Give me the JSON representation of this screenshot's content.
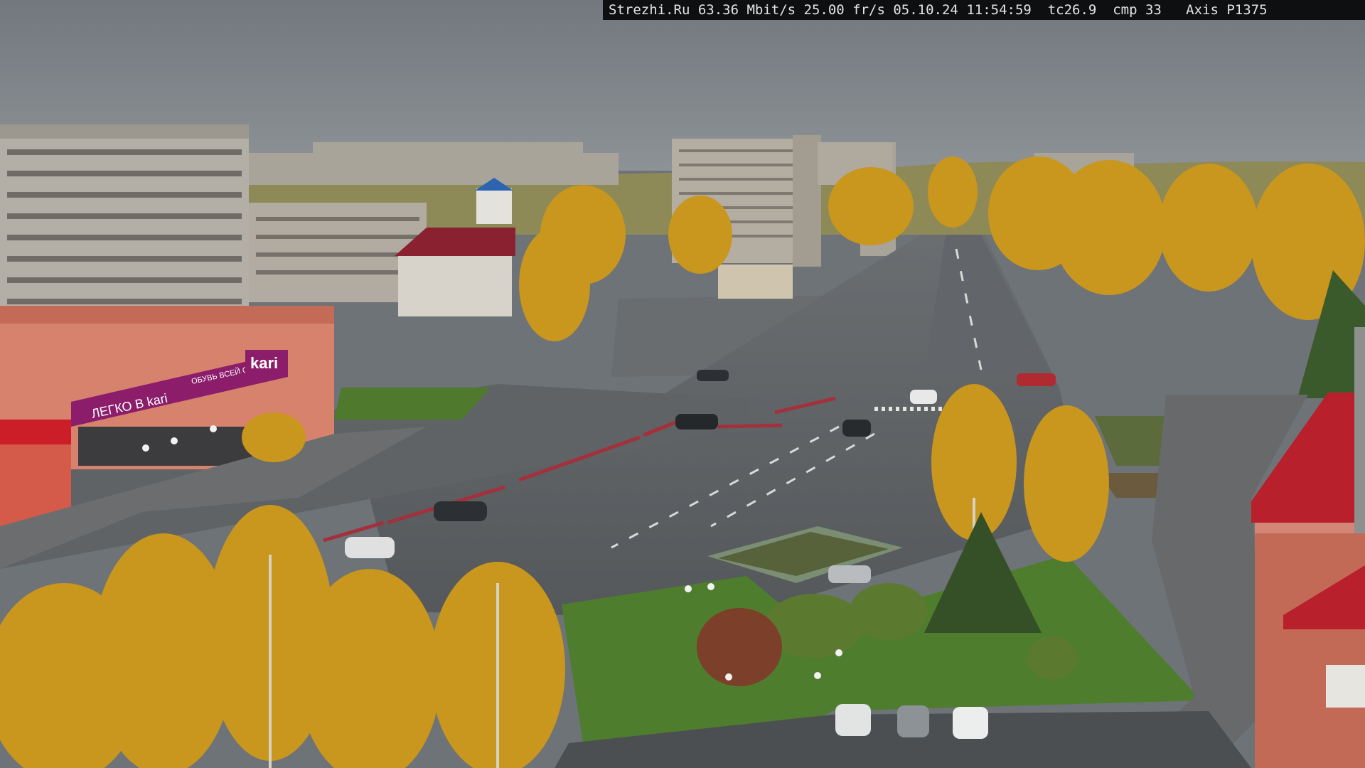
{
  "overlay": {
    "osd_text": "Strezhi.Ru 63.36 Mbit/s 25.00 fr/s 05.10.24 11:54:59  tc26.9  cmp 33   Axis P1375"
  },
  "signs": {
    "store_logo": "kari",
    "store_banner": "ЛЕГКО В kari",
    "store_banner_small": "ОБУВЬ ВСЕЙ СЕМЬИ"
  },
  "colors": {
    "sky": "#7d8389",
    "asphalt": "#5b5f62",
    "grass": "#4f7d2e",
    "autumn_foliage": "#c9961e",
    "kari_magenta": "#8b1d6a",
    "roof_red": "#b8202c"
  }
}
